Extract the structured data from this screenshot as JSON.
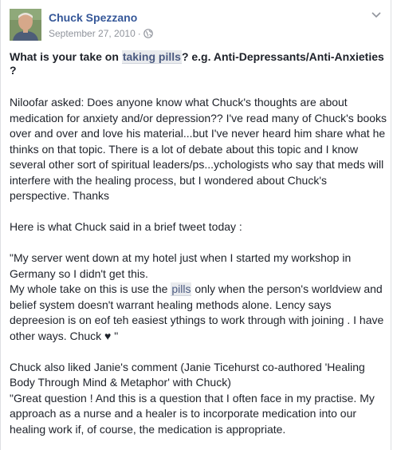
{
  "post": {
    "author": "Chuck Spezzano",
    "date": "September 27, 2010",
    "meta_separator": "·",
    "title": {
      "prefix": "What is your take on ",
      "highlight": "taking pills",
      "suffix": "? e.g. Anti-Depressants/Anti-Anxieties ?"
    },
    "paragraph1": "Niloofar asked: Does anyone know what Chuck's thoughts are about medication for anxiety and/or depression?? I've read many of Chuck's books over and over and love his material...but I've never heard him share what he thinks on that topic. There is a lot of debate about this topic and I know several other sort of spiritual leaders/ps...ychologists who say that meds will interfere with the healing process, but I wondered about Chuck's perspective. Thanks",
    "paragraph2": "Here is what Chuck said in a brief tweet today :",
    "quote_line1": "\"My server went down at my hotel just when I started my workshop in Germany so I didn't get this.",
    "quote_line2": {
      "prefix": "My whole take on this is use the ",
      "highlight": "pills",
      "suffix": " only when the person's worldview and belief system doesn't warrant healing methods alone. Lency says depreesion is on eof teh easiest ythings to work through with joining . I have other ways. Chuck ♥ \""
    },
    "paragraph4_line1": "Chuck also liked Janie's comment (Janie Ticehurst co-authored 'Healing Body Through Mind & Metaphor' with Chuck)",
    "paragraph4_line2": "\"Great question ! And this is a question that I often face in my practise. My approach as a nurse and a healer is to incorporate medication into our healing work if, of course, the medication is appropriate."
  },
  "icons": {
    "avatar": "avatar-photo",
    "privacy": "globe-icon",
    "options": "chevron-down-icon"
  },
  "colors": {
    "link": "#365899",
    "meta": "#90949c",
    "text": "#1d2129",
    "highlight_bg": "#e9ebee"
  }
}
